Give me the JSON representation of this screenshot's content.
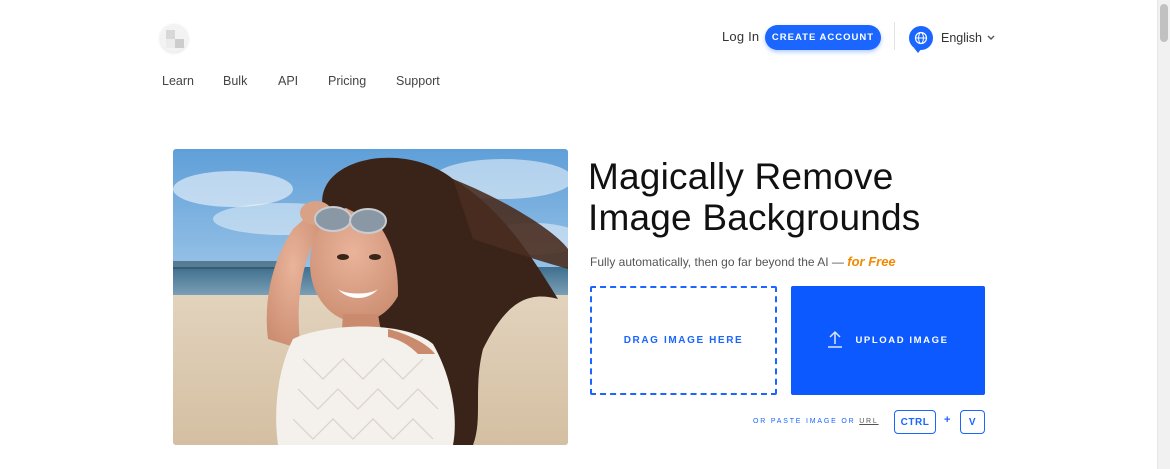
{
  "header": {
    "login_label": "Log In",
    "create_account_label": "CREATE ACCOUNT",
    "language_label": "English"
  },
  "nav": {
    "items": [
      {
        "label": "Learn"
      },
      {
        "label": "Bulk"
      },
      {
        "label": "API"
      },
      {
        "label": "Pricing"
      },
      {
        "label": "Support"
      }
    ]
  },
  "hero": {
    "headline_line1": "Magically Remove",
    "headline_line2": "Image Backgrounds",
    "subtitle": "Fully automatically, then go far beyond the AI —",
    "subtitle_highlight": "for Free",
    "drop_label": "DRAG IMAGE HERE",
    "upload_label": "UPLOAD IMAGE",
    "paste_prefix": "OR PASTE IMAGE OR",
    "paste_url": "URL",
    "key_ctrl": "CTRL",
    "key_plus": "+",
    "key_v": "V"
  },
  "colors": {
    "accent": "#1a66ff",
    "upload_bg": "#0b59ff",
    "free_highlight": "#f08a00"
  },
  "icons": [
    "logo-icon",
    "globe-icon",
    "chevron-down-icon",
    "upload-arrow-icon"
  ]
}
